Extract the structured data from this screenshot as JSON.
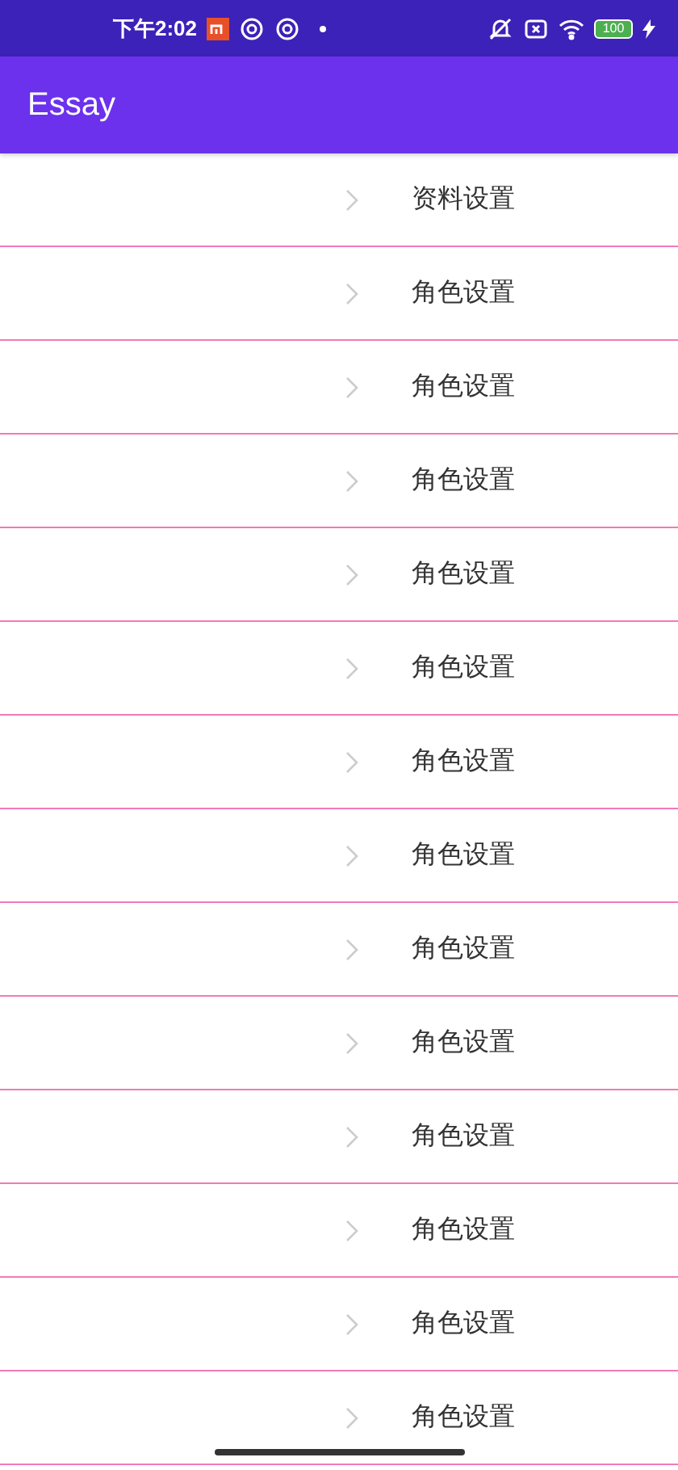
{
  "status_bar": {
    "time": "下午2:02",
    "battery": "100"
  },
  "app_bar": {
    "title": "Essay"
  },
  "items": [
    {
      "label": "资料设置"
    },
    {
      "label": "角色设置"
    },
    {
      "label": "角色设置"
    },
    {
      "label": "角色设置"
    },
    {
      "label": "角色设置"
    },
    {
      "label": "角色设置"
    },
    {
      "label": "角色设置"
    },
    {
      "label": "角色设置"
    },
    {
      "label": "角色设置"
    },
    {
      "label": "角色设置"
    },
    {
      "label": "角色设置"
    },
    {
      "label": "角色设置"
    },
    {
      "label": "角色设置"
    },
    {
      "label": "角色设置"
    }
  ]
}
